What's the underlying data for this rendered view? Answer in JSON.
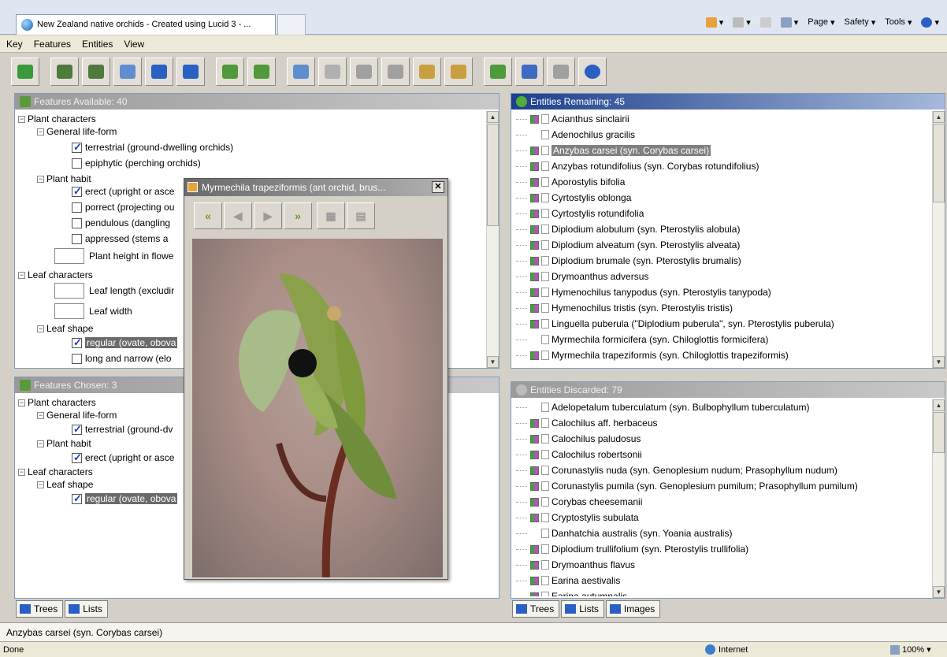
{
  "browser": {
    "tab_title": "New Zealand native orchids - Created using Lucid 3 - ...",
    "commands": [
      "Page",
      "Safety",
      "Tools"
    ],
    "status_text": "Done",
    "zone": "Internet",
    "zoom": "100%"
  },
  "menu": [
    "Key",
    "Features",
    "Entities",
    "View"
  ],
  "toolbar_icons": [
    "restart-icon",
    "features-icon",
    "entities-icon",
    "find-icon",
    "list-icon",
    "tree-icon",
    "image-icon",
    "image2-icon",
    "pointer-icon",
    "wand-icon",
    "prune-icon",
    "prune2-icon",
    "differences-icon",
    "best-icon",
    "similar-icon",
    "subset-icon",
    "compare-icon",
    "help-icon"
  ],
  "features_available": {
    "header": "Features Available: 40",
    "rows": [
      {
        "label": "Plant characters"
      },
      {
        "label": "General life-form"
      },
      {
        "label": "terrestrial (ground-dwelling orchids)",
        "checked": true
      },
      {
        "label": "epiphytic (perching orchids)",
        "checked": false
      },
      {
        "label": "Plant habit"
      },
      {
        "label": "erect (upright or asce",
        "checked": true
      },
      {
        "label": "porrect (projecting ou",
        "checked": false
      },
      {
        "label": "pendulous (dangling",
        "checked": false
      },
      {
        "label": "appressed (stems a",
        "checked": false
      },
      {
        "label": "Plant height in flowe"
      },
      {
        "label": "Leaf characters"
      },
      {
        "label": "Leaf length (excludir"
      },
      {
        "label": "Leaf width"
      },
      {
        "label": "Leaf shape"
      },
      {
        "label": "regular (ovate, obova",
        "checked": true
      },
      {
        "label": "long and narrow (elo",
        "checked": false
      }
    ]
  },
  "features_chosen": {
    "header": "Features Chosen: 3",
    "rows": [
      {
        "label": "Plant characters"
      },
      {
        "label": "General life-form"
      },
      {
        "label": "terrestrial (ground-dv",
        "checked": true
      },
      {
        "label": "Plant habit"
      },
      {
        "label": "erect (upright or asce",
        "checked": true
      },
      {
        "label": "Leaf characters"
      },
      {
        "label": "Leaf shape"
      },
      {
        "label": "regular (ovate, obova",
        "checked": true
      }
    ]
  },
  "left_tabs": [
    "Trees",
    "Lists"
  ],
  "right_tabs": [
    "Trees",
    "Lists",
    "Images"
  ],
  "entities_remaining": {
    "header": "Entities Remaining: 45",
    "items": [
      "Acianthus sinclairii",
      "Adenochilus gracilis",
      "Anzybas carsei (syn. Corybas carsei)",
      "Anzybas rotundifolius (syn. Corybas rotundifolius)",
      "Aporostylis bifolia",
      "Cyrtostylis oblonga",
      "Cyrtostylis rotundifolia",
      "Diplodium alobulum (syn. Pterostylis alobula)",
      "Diplodium alveatum (syn. Pterostylis alveata)",
      "Diplodium brumale (syn. Pterostylis brumalis)",
      "Drymoanthus adversus",
      "Hymenochilus tanypodus (syn. Pterostylis tanypoda)",
      "Hymenochilus tristis (syn. Pterostylis tristis)",
      "Linguella puberula (\"Diplodium puberula\", syn. Pterostylis puberula)",
      "Myrmechila formicifera (syn. Chiloglottis formicifera)",
      "Myrmechila trapeziformis (syn. Chiloglottis trapeziformis)"
    ]
  },
  "entities_discarded": {
    "header": "Entities Discarded: 79",
    "items": [
      "Adelopetalum tuberculatum (syn. Bulbophyllum tuberculatum)",
      "Calochilus aff. herbaceus",
      "Calochilus paludosus",
      "Calochilus robertsonii",
      "Corunastylis nuda (syn. Genoplesium nudum; Prasophyllum nudum)",
      "Corunastylis pumila (syn. Genoplesium pumilum; Prasophyllum pumilum)",
      "Corybas cheesemanii",
      "Cryptostylis subulata",
      "Danhatchia australis (syn. Yoania australis)",
      "Diplodium trullifolium (syn. Pterostylis trullifolia)",
      "Drymoanthus flavus",
      "Earina aestivalis",
      "Earina autumnalis"
    ]
  },
  "popup": {
    "title": "Myrmechila trapeziformis (ant orchid, brus..."
  },
  "selected_entity": "Anzybas carsei (syn. Corybas carsei)"
}
